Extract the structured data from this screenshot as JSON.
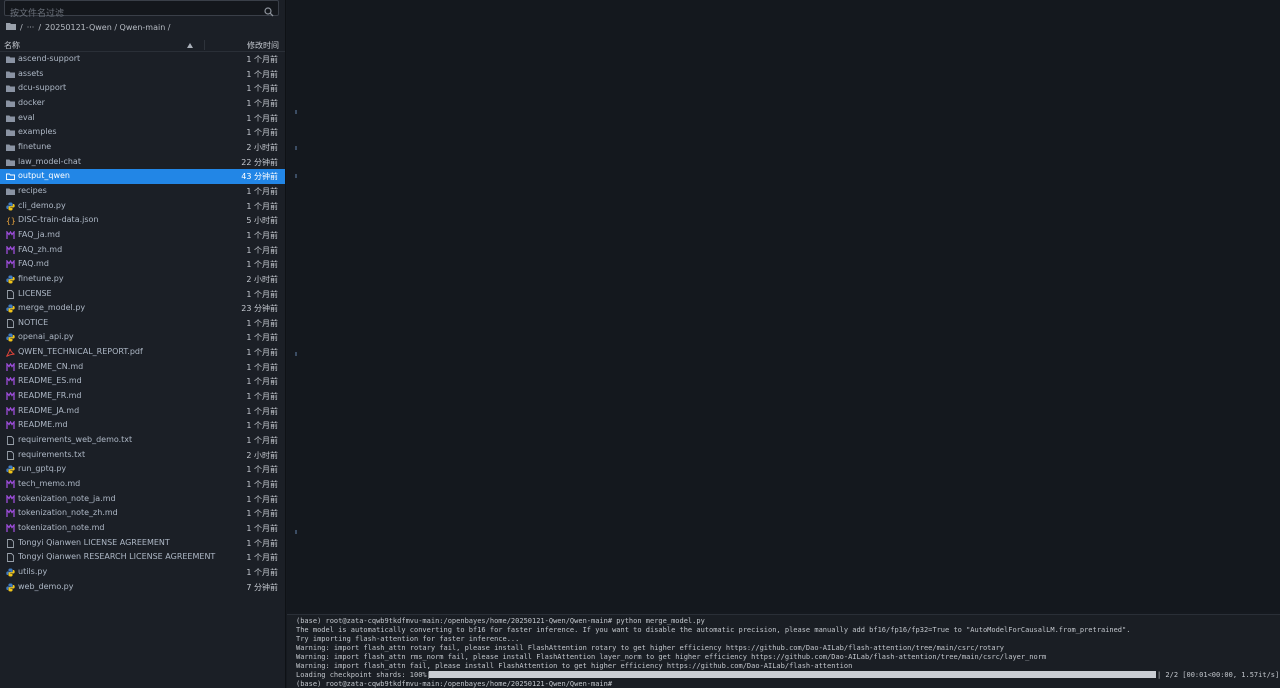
{
  "search": {
    "placeholder": "按文件名过滤"
  },
  "breadcrumb": {
    "root": "/",
    "ellipsis": "···",
    "sep": "/",
    "path": "20250121-Qwen / Qwen-main /"
  },
  "columns": {
    "name": "名称",
    "modified": "修改时间"
  },
  "files": [
    {
      "name": "ascend-support",
      "time": "1 个月前",
      "icon": "folder-icon"
    },
    {
      "name": "assets",
      "time": "1 个月前",
      "icon": "folder-icon"
    },
    {
      "name": "dcu-support",
      "time": "1 个月前",
      "icon": "folder-icon"
    },
    {
      "name": "docker",
      "time": "1 个月前",
      "icon": "folder-icon"
    },
    {
      "name": "eval",
      "time": "1 个月前",
      "icon": "folder-icon"
    },
    {
      "name": "examples",
      "time": "1 个月前",
      "icon": "folder-icon"
    },
    {
      "name": "finetune",
      "time": "2 小时前",
      "icon": "folder-icon"
    },
    {
      "name": "law_model-chat",
      "time": "22 分钟前",
      "icon": "folder-icon"
    },
    {
      "name": "output_qwen",
      "time": "43 分钟前",
      "icon": "folder-icon",
      "selected": true
    },
    {
      "name": "recipes",
      "time": "1 个月前",
      "icon": "folder-icon"
    },
    {
      "name": "cli_demo.py",
      "time": "1 个月前",
      "icon": "python-icon"
    },
    {
      "name": "DISC-train-data.json",
      "time": "5 小时前",
      "icon": "json-icon"
    },
    {
      "name": "FAQ_ja.md",
      "time": "1 个月前",
      "icon": "markdown-icon"
    },
    {
      "name": "FAQ_zh.md",
      "time": "1 个月前",
      "icon": "markdown-icon"
    },
    {
      "name": "FAQ.md",
      "time": "1 个月前",
      "icon": "markdown-icon"
    },
    {
      "name": "finetune.py",
      "time": "2 小时前",
      "icon": "python-icon"
    },
    {
      "name": "LICENSE",
      "time": "1 个月前",
      "icon": "file-icon"
    },
    {
      "name": "merge_model.py",
      "time": "23 分钟前",
      "icon": "python-icon"
    },
    {
      "name": "NOTICE",
      "time": "1 个月前",
      "icon": "file-icon"
    },
    {
      "name": "openai_api.py",
      "time": "1 个月前",
      "icon": "python-icon"
    },
    {
      "name": "QWEN_TECHNICAL_REPORT.pdf",
      "time": "1 个月前",
      "icon": "pdf-icon"
    },
    {
      "name": "README_CN.md",
      "time": "1 个月前",
      "icon": "markdown-icon"
    },
    {
      "name": "README_ES.md",
      "time": "1 个月前",
      "icon": "markdown-icon"
    },
    {
      "name": "README_FR.md",
      "time": "1 个月前",
      "icon": "markdown-icon"
    },
    {
      "name": "README_JA.md",
      "time": "1 个月前",
      "icon": "markdown-icon"
    },
    {
      "name": "README.md",
      "time": "1 个月前",
      "icon": "markdown-icon"
    },
    {
      "name": "requirements_web_demo.txt",
      "time": "1 个月前",
      "icon": "file-icon"
    },
    {
      "name": "requirements.txt",
      "time": "2 小时前",
      "icon": "file-icon"
    },
    {
      "name": "run_gptq.py",
      "time": "1 个月前",
      "icon": "python-icon"
    },
    {
      "name": "tech_memo.md",
      "time": "1 个月前",
      "icon": "markdown-icon"
    },
    {
      "name": "tokenization_note_ja.md",
      "time": "1 个月前",
      "icon": "markdown-icon"
    },
    {
      "name": "tokenization_note_zh.md",
      "time": "1 个月前",
      "icon": "markdown-icon"
    },
    {
      "name": "tokenization_note.md",
      "time": "1 个月前",
      "icon": "markdown-icon"
    },
    {
      "name": "Tongyi Qianwen LICENSE AGREEMENT",
      "time": "1 个月前",
      "icon": "file-icon"
    },
    {
      "name": "Tongyi Qianwen RESEARCH LICENSE AGREEMENT",
      "time": "1 个月前",
      "icon": "file-icon"
    },
    {
      "name": "utils.py",
      "time": "1 个月前",
      "icon": "python-icon"
    },
    {
      "name": "web_demo.py",
      "time": "7 分钟前",
      "icon": "python-icon"
    }
  ],
  "terminal": {
    "lines": [
      "(base) root@zata-cqwb9tkdfmvu-main:/openbayes/home/20250121-Qwen/Qwen-main# python merge_model.py",
      "The model is automatically converting to bf16 for faster inference. If you want to disable the automatic precision, please manually add bf16/fp16/fp32=True to \"AutoModelForCausalLM.from_pretrained\".",
      "Try importing flash-attention for faster inference...",
      "Warning: import flash_attn rotary fail, please install FlashAttention rotary to get higher efficiency https://github.com/Dao-AILab/flash-attention/tree/main/csrc/rotary",
      "Warning: import flash_attn rms_norm fail, please install FlashAttention layer_norm to get higher efficiency https://github.com/Dao-AILab/flash-attention/tree/main/csrc/layer_norm",
      "Warning: import flash_attn fail, please install FlashAttention to get higher efficiency https://github.com/Dao-AILab/flash-attention"
    ],
    "progress_label": "Loading checkpoint shards: 100%|",
    "progress_fraction": 1.0,
    "progress_stats": "| 2/2 [00:01<00:00,  1.57it/s]",
    "prompt": "(base) root@zata-cqwb9tkdfmvu-main:/openbayes/home/20250121-Qwen/Qwen-main#"
  },
  "colors": {
    "accent": "#2286e6",
    "folder": "#8a93a3",
    "python_blue": "#3f7cc4",
    "python_yellow": "#f0c419",
    "markdown": "#9b4dd8",
    "pdf": "#e0443a",
    "json": "#e8a33d"
  }
}
